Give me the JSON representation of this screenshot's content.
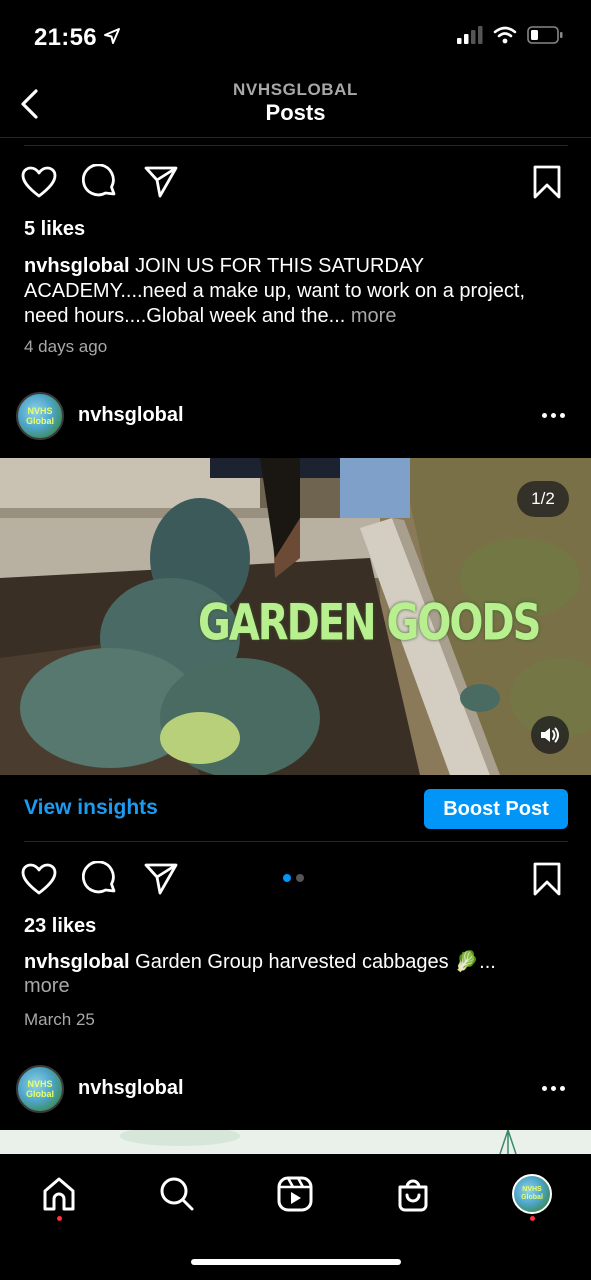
{
  "status_bar": {
    "time": "21:56",
    "icons": [
      "location-arrow-icon",
      "signal-icon",
      "wifi-icon",
      "battery-icon"
    ]
  },
  "header": {
    "account": "NVHSGLOBAL",
    "title": "Posts"
  },
  "post1": {
    "likes": "5 likes",
    "username": "nvhsglobal",
    "caption": "JOIN US FOR THIS SATURDAY ACADEMY....need a make up, want to work on a project, need hours....Global week and the...",
    "more": "more",
    "time_ago": "4 days ago"
  },
  "post2": {
    "username": "nvhsglobal",
    "avatar_text": "NVHS Global",
    "media_counter": "1/2",
    "media_overlay_text": "GARDEN GOODS",
    "view_insights": "View insights",
    "boost_post": "Boost Post",
    "carousel": {
      "total": 2,
      "active": 1
    },
    "likes": "23 likes",
    "caption": "Garden Group harvested cabbages 🥬...",
    "more": "more",
    "date": "March 25"
  },
  "post3": {
    "username": "nvhsglobal",
    "avatar_text": "NVHS Global"
  },
  "tab_bar": {
    "tabs": [
      "home",
      "search",
      "reels",
      "shop",
      "profile"
    ],
    "active": "home"
  },
  "colors": {
    "background": "#000000",
    "accent_blue": "#0095f6",
    "link_blue": "#1d9bf0",
    "secondary_text": "#a8a8a8",
    "notification_red": "#ff3040"
  }
}
